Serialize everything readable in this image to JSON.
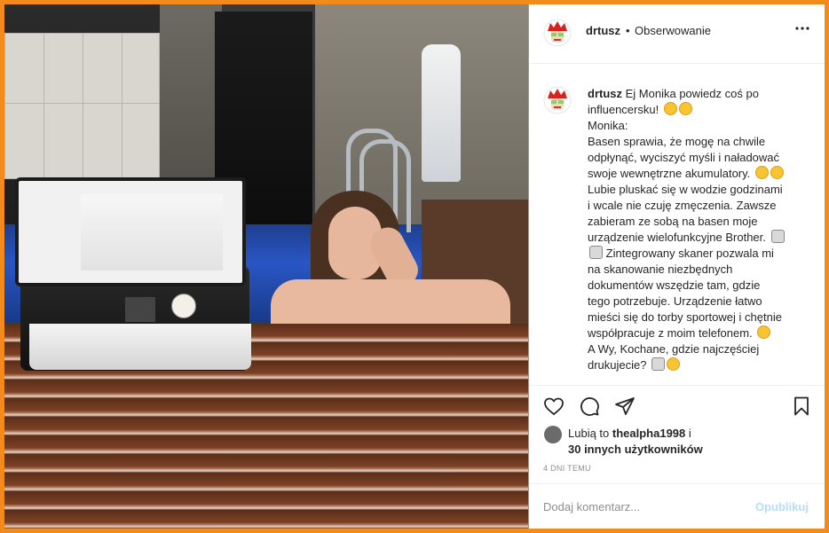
{
  "header": {
    "username": "drtusz",
    "separator": "•",
    "follow_label": "Obserwowanie",
    "more_label": "•••"
  },
  "caption": {
    "username": "drtusz",
    "lines": [
      "Ej Monika powiedz coś po",
      "influencersku!",
      "Monika:",
      "Basen sprawia, że mogę na chwile",
      "odpłynąć, wyciszyć myśli i naładować",
      "swoje wewnętrzne akumulatory.",
      "Lubie pluskać się w wodzie godzinami",
      "i wcale nie czuję zmęczenia. Zawsze",
      "zabieram ze sobą na basen moje",
      "urządzenie wielofunkcyjne Brother.",
      "Zintegrowany skaner pozwala mi",
      "na skanowanie niezbędnych",
      "dokumentów wszędzie tam, gdzie",
      "tego potrzebuje. Urządzenie łatwo",
      "mieści się do torby sportowej i chętnie",
      "współpracuje z moim telefonem.",
      "A Wy, Kochane, gdzie najczęściej",
      "drukujecie?"
    ]
  },
  "actions": {
    "like_icon": "heart-icon",
    "comment_icon": "comment-icon",
    "share_icon": "send-icon",
    "save_icon": "bookmark-icon"
  },
  "likes": {
    "prefix": "Lubią to",
    "user": "thealpha1998",
    "connector": "i",
    "others": "30 innych użytkowników"
  },
  "timestamp": "4 DNI TEMU",
  "comment": {
    "placeholder": "Dodaj komentarz...",
    "publish_label": "Opublikuj"
  },
  "colors": {
    "frame": "#f28a1c",
    "publish_disabled": "#b2dffc",
    "text": "#262626",
    "muted": "#8e8e8e"
  }
}
